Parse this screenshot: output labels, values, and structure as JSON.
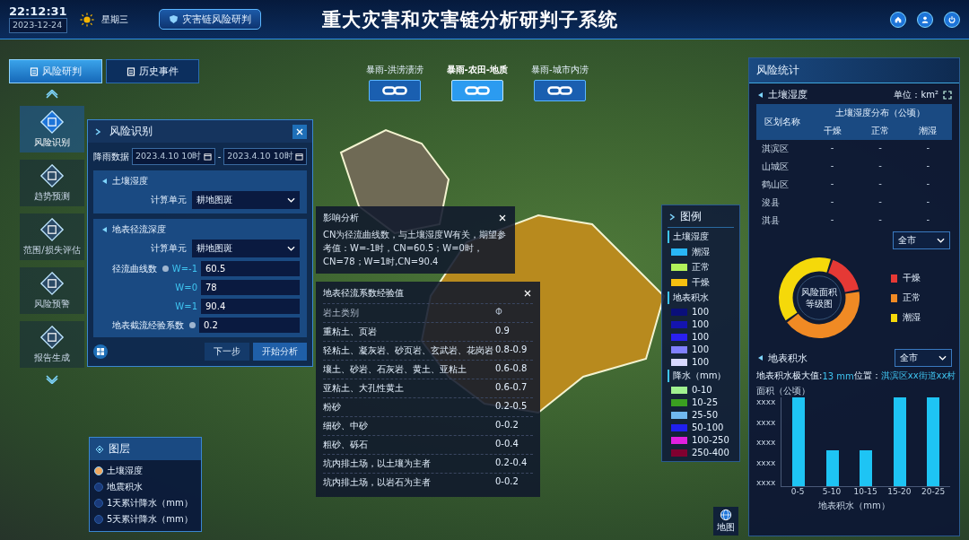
{
  "header": {
    "time": "22:12:31",
    "date": "2023-12-24",
    "weekday": "星期三",
    "badge": "灾害链风险研判",
    "title": "重大灾害和灾害链分析研判子系统"
  },
  "main_tabs": [
    {
      "label": "风险研判",
      "selected": true
    },
    {
      "label": "历史事件",
      "selected": false
    }
  ],
  "scenarios": [
    {
      "label": "暴雨-洪涝渍涝",
      "selected": false
    },
    {
      "label": "暴雨-农田-地质",
      "selected": true
    },
    {
      "label": "暴雨-城市内涝",
      "selected": false
    }
  ],
  "nav": [
    {
      "label": "风险识别",
      "selected": true
    },
    {
      "label": "趋势预测",
      "selected": false
    },
    {
      "label": "范围/损失评估",
      "selected": false
    },
    {
      "label": "风险预警",
      "selected": false
    },
    {
      "label": "报告生成",
      "selected": false
    }
  ],
  "risk_panel": {
    "title": "风险识别",
    "rain_label": "降雨数据",
    "date_from": "2023.4.10 10时",
    "date_sep": "-",
    "date_to": "2023.4.10 10时",
    "soil": {
      "title": "土壤湿度",
      "unit_label": "计算单元",
      "unit_value": "耕地图斑"
    },
    "runoff": {
      "title": "地表径流深度",
      "unit_label": "计算单元",
      "unit_value": "耕地图斑",
      "cn_label": "径流曲线数",
      "cn_rows": [
        {
          "w": "W=-1",
          "value": "60.5"
        },
        {
          "w": "W=0",
          "value": "78"
        },
        {
          "w": "W=1",
          "value": "90.4"
        }
      ],
      "coef_label": "地表截流经验系数",
      "coef_value": "0.2"
    },
    "buttons": [
      "下一步",
      "开始分析"
    ]
  },
  "influence_popup": {
    "title": "影响分析",
    "text": "CN为径流曲线数，与土壤湿度W有关，期望参考值：W=-1时，CN=60.5；W=0时，CN=78；W=1时,CN=90.4"
  },
  "coef_popup": {
    "title": "地表径流系数经验值",
    "columns": [
      "岩土类别",
      "Φ"
    ],
    "rows": [
      [
        "重粘土、页岩",
        "0.9"
      ],
      [
        "轻粘土、凝灰岩、砂页岩、玄武岩、花岗岩",
        "0.8-0.9"
      ],
      [
        "壤土、砂岩、石灰岩、黄土、亚粘土",
        "0.6-0.8"
      ],
      [
        "亚粘土、大孔性黄土",
        "0.6-0.7"
      ],
      [
        "粉砂",
        "0.2-0.5"
      ],
      [
        "细砂、中砂",
        "0-0.2"
      ],
      [
        "粗砂、砾石",
        "0-0.4"
      ],
      [
        "坑内排土场，以土壤为主者",
        "0.2-0.4"
      ],
      [
        "坑内排土场，以岩石为主者",
        "0-0.2"
      ]
    ]
  },
  "legend": {
    "title": "图例",
    "groups": [
      {
        "title": "土壤湿度",
        "items": [
          {
            "label": "潮湿",
            "color": "#29b6f6"
          },
          {
            "label": "正常",
            "color": "#b2f25a"
          },
          {
            "label": "干燥",
            "color": "#f5c010"
          }
        ]
      },
      {
        "title": "地表积水",
        "items": [
          {
            "label": "100",
            "color": "#0a0f7a"
          },
          {
            "label": "100",
            "color": "#1414b0"
          },
          {
            "label": "100",
            "color": "#2a20f0"
          },
          {
            "label": "100",
            "color": "#8080ff"
          },
          {
            "label": "100",
            "color": "#d8d8ff"
          }
        ]
      },
      {
        "title": "降水（mm）",
        "items": [
          {
            "label": "0-10",
            "color": "#a0f090"
          },
          {
            "label": "10-25",
            "color": "#3aa020"
          },
          {
            "label": "25-50",
            "color": "#70b8f0"
          },
          {
            "label": "50-100",
            "color": "#2020f0"
          },
          {
            "label": "100-250",
            "color": "#e020e0"
          },
          {
            "label": "250-400",
            "color": "#800030"
          }
        ]
      }
    ]
  },
  "layers": {
    "title": "图层",
    "items": [
      {
        "label": "土壤湿度",
        "selected": true
      },
      {
        "label": "地震积水",
        "selected": false
      },
      {
        "label": "1天累计降水（mm）",
        "selected": false
      },
      {
        "label": "5天累计降水（mm）",
        "selected": false
      }
    ]
  },
  "stats": {
    "title": "风险统计",
    "soil": {
      "title": "土壤湿度",
      "unit": "单位：km²",
      "region_header": "区划名称",
      "group_header": "土壤湿度分布（公顷）",
      "columns": [
        "干燥",
        "正常",
        "潮湿"
      ],
      "rows": [
        {
          "name": "淇滨区",
          "values": [
            "-",
            "-",
            "-"
          ]
        },
        {
          "name": "山城区",
          "values": [
            "-",
            "-",
            "-"
          ]
        },
        {
          "name": "鹤山区",
          "values": [
            "-",
            "-",
            "-"
          ]
        },
        {
          "name": "浚县",
          "values": [
            "-",
            "-",
            "-"
          ]
        },
        {
          "name": "淇县",
          "values": [
            "-",
            "-",
            "-"
          ]
        }
      ]
    },
    "filter": "全市",
    "donut": {
      "center_lines": [
        "风险面积",
        "等级图"
      ],
      "legend": [
        {
          "label": "干燥",
          "color": "#e53935"
        },
        {
          "label": "正常",
          "color": "#f08a24"
        },
        {
          "label": "潮湿",
          "color": "#f5d90a"
        }
      ]
    },
    "water": {
      "title": "地表积水",
      "filter": "全市",
      "max_label": "地表积水极大值:",
      "max_value": "13 mm",
      "loc_label": "位置：",
      "loc_value": "淇滨区xx街道xx村",
      "ylabel": "面积（公顷）",
      "yticks": [
        "xxxx",
        "xxxx",
        "xxxx",
        "xxxx",
        "xxxx"
      ],
      "categories": [
        "0-5",
        "5-10",
        "10-15",
        "15-20",
        "20-25"
      ],
      "xlabel": "地表积水（mm）"
    }
  },
  "map_button": "地图"
}
